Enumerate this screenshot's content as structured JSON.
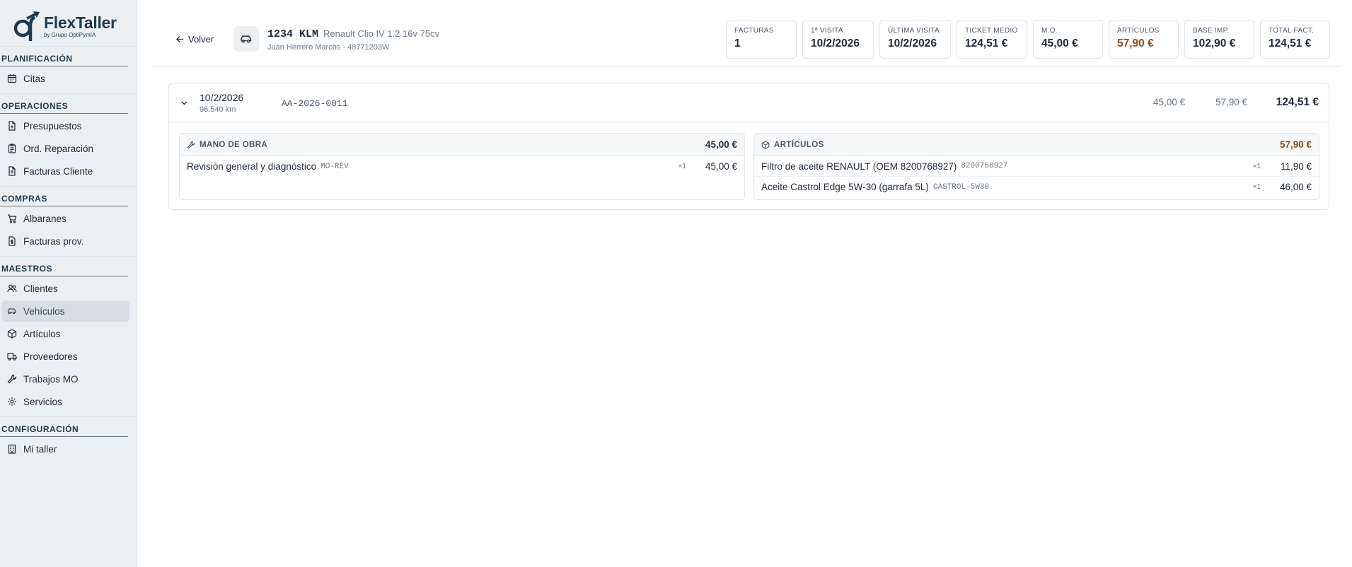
{
  "brand": {
    "name": "FlexTaller",
    "subtitle": "by Grupo OptiPymIA"
  },
  "sidebar": {
    "sections": [
      {
        "title": "PLANIFICACIÓN",
        "items": [
          {
            "label": "Citas",
            "icon": "calendar-icon"
          }
        ]
      },
      {
        "title": "OPERACIONES",
        "items": [
          {
            "label": "Presupuestos",
            "icon": "document-plus-icon"
          },
          {
            "label": "Ord. Reparación",
            "icon": "clipboard-icon"
          },
          {
            "label": "Facturas Cliente",
            "icon": "document-icon"
          }
        ]
      },
      {
        "title": "COMPRAS",
        "items": [
          {
            "label": "Albaranes",
            "icon": "cart-icon"
          },
          {
            "label": "Facturas prov.",
            "icon": "invoice-dollar-icon"
          }
        ]
      },
      {
        "title": "MAESTROS",
        "items": [
          {
            "label": "Clientes",
            "icon": "users-icon"
          },
          {
            "label": "Vehículos",
            "icon": "car-icon",
            "active": true
          },
          {
            "label": "Artículos",
            "icon": "box-icon"
          },
          {
            "label": "Proveedores",
            "icon": "truck-icon"
          },
          {
            "label": "Trabajos MO",
            "icon": "wrench-icon"
          },
          {
            "label": "Servicios",
            "icon": "gear-icon"
          }
        ]
      },
      {
        "title": "CONFIGURACIÓN",
        "items": [
          {
            "label": "Mi taller",
            "icon": "building-icon"
          }
        ]
      }
    ]
  },
  "header": {
    "back_label": "Volver",
    "plate": "1234 KLM",
    "model": "Renault Clio IV 1.2 16v 75cv",
    "owner": "Juan Herrero Marcos · 48771203W"
  },
  "kpis": {
    "facturas": {
      "label": "FACTURAS",
      "value": "1"
    },
    "primera": {
      "label": "1ª VISITA",
      "value": "10/2/2026"
    },
    "ultima": {
      "label": "ÚLTIMA VISITA",
      "value": "10/2/2026"
    },
    "ticket": {
      "label": "TICKET MEDIO",
      "value": "124,51 €"
    },
    "mo": {
      "label": "M.O.",
      "value": "45,00 €"
    },
    "articulos": {
      "label": "ARTÍCULOS",
      "value": "57,90 €"
    },
    "base": {
      "label": "BASE IMP.",
      "value": "102,90 €"
    },
    "total": {
      "label": "TOTAL FACT.",
      "value": "124,51 €"
    }
  },
  "invoice": {
    "date": "10/2/2026",
    "km": "96.540 km",
    "number": "AA-2026-0011",
    "mo_total": "45,00 €",
    "art_total": "57,90 €",
    "total": "124,51 €",
    "labor": {
      "title": "MANO DE OBRA",
      "total": "45,00 €",
      "lines": [
        {
          "desc": "Revisión general y diagnóstico",
          "code": "MO-REV",
          "qty": "×1",
          "price": "45,00 €"
        }
      ]
    },
    "parts": {
      "title": "ARTÍCULOS",
      "total": "57,90 €",
      "lines": [
        {
          "desc": "Filtro de aceite RENAULT (OEM 8200768927)",
          "code": "8200768927",
          "qty": "×1",
          "price": "11,90 €"
        },
        {
          "desc": "Aceite Castrol Edge 5W-30 (garrafa 5L)",
          "code": "CASTROL-5W30",
          "qty": "×1",
          "price": "46,00 €"
        }
      ]
    }
  },
  "colors": {
    "brand": "#1e3a4c",
    "accent": "#8a4a1c",
    "sidebar_bg": "#eceff2"
  }
}
